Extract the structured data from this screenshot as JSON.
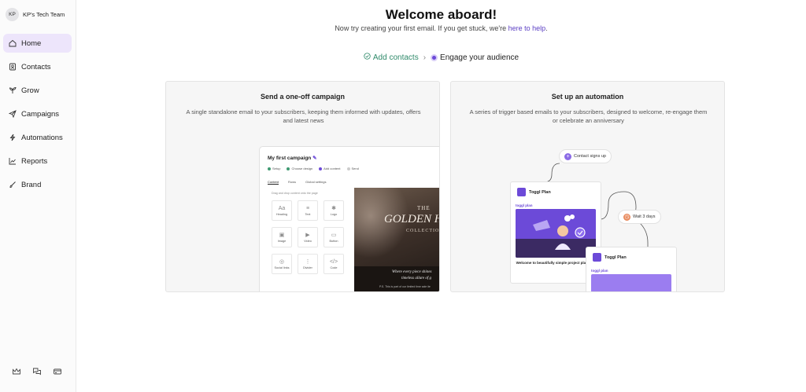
{
  "sidebar": {
    "team": {
      "initials": "KP",
      "name": "KP's Tech Team"
    },
    "items": [
      {
        "label": "Home",
        "icon": "home-icon",
        "active": true
      },
      {
        "label": "Contacts",
        "icon": "contacts-icon"
      },
      {
        "label": "Grow",
        "icon": "sprout-icon"
      },
      {
        "label": "Campaigns",
        "icon": "send-icon"
      },
      {
        "label": "Automations",
        "icon": "bolt-icon"
      },
      {
        "label": "Reports",
        "icon": "chart-icon"
      },
      {
        "label": "Brand",
        "icon": "brush-icon"
      }
    ],
    "bottom_icons": [
      "crown-icon",
      "chat-icon",
      "billing-icon"
    ]
  },
  "header": {
    "title": "Welcome aboard!",
    "subtitle_prefix": "Now try creating your first email. If you get stuck, we're ",
    "subtitle_link": "here to help",
    "subtitle_suffix": "."
  },
  "steps": {
    "done": "Add contacts",
    "current": "Engage your audience"
  },
  "cards": {
    "campaign": {
      "title": "Send a one-off campaign",
      "description": "A single standalone email to your subscribers, keeping them informed with updates, offers and latest news",
      "preview": {
        "title": "My first campaign",
        "steps": [
          "Setup",
          "Choose design",
          "Add content",
          "Send"
        ],
        "tabs": [
          "Content",
          "Rows",
          "Global settings"
        ],
        "hint": "Drag and drop content onto the page",
        "blocks": [
          {
            "glyph": "Aa",
            "label": "Heading"
          },
          {
            "glyph": "≡",
            "label": "Text"
          },
          {
            "glyph": "✱",
            "label": "Logo"
          },
          {
            "glyph": "▣",
            "label": "Image"
          },
          {
            "glyph": "▶",
            "label": "Video"
          },
          {
            "glyph": "▭",
            "label": "Button"
          },
          {
            "glyph": "◎",
            "label": "Social links"
          },
          {
            "glyph": "⋮",
            "label": "Divider"
          },
          {
            "glyph": "</>",
            "label": "Code"
          }
        ],
        "image_the": "THE",
        "image_headline": "GOLDEN H",
        "image_collection": "COLLECTIO",
        "caption_1": "Where every piece shines",
        "caption_2": "timeless allure of g",
        "caption_3": "P.S. This is part of our limited time sale ite"
      }
    },
    "automation": {
      "title": "Set up an automation",
      "description": "A series of trigger based emails to your subscribers, designed to welcome, re-engage them or celebrate an anniversary",
      "trigger": "Contact signs up",
      "wait": "Wait 3 days",
      "email_sender": "Toggl Plan",
      "email_brand": "toggl plan",
      "email_caption": "Welcome to beautifully simple project planning",
      "accent": "#6c4ad8"
    }
  }
}
